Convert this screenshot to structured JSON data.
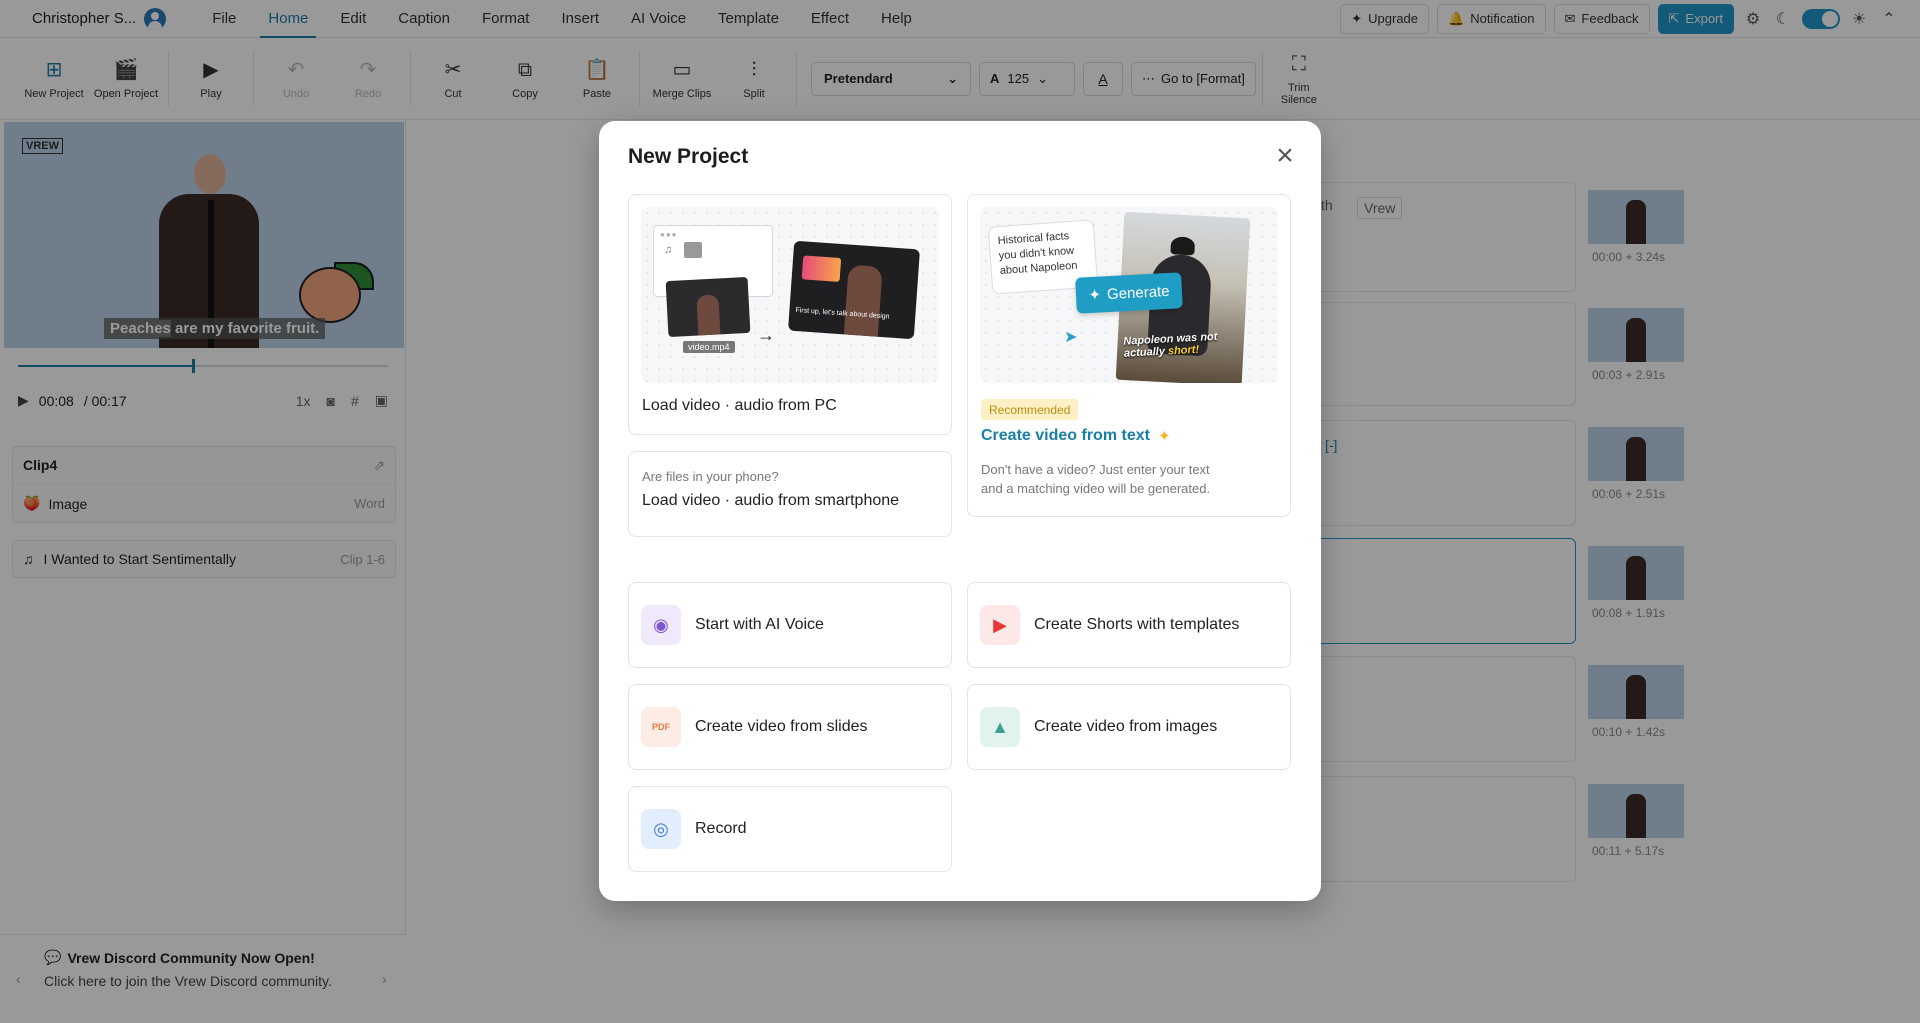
{
  "header": {
    "user_name": "Christopher S...",
    "menus": [
      "File",
      "Home",
      "Edit",
      "Caption",
      "Format",
      "Insert",
      "AI Voice",
      "Template",
      "Effect",
      "Help"
    ],
    "active_menu": "Home",
    "upgrade_label": "Upgrade",
    "notification_label": "Notification",
    "feedback_label": "Feedback",
    "export_label": "Export",
    "accent_color": "#2196c9"
  },
  "toolbar": {
    "new_project": "New Project",
    "open_project": "Open Project",
    "play": "Play",
    "undo": "Undo",
    "redo": "Redo",
    "cut": "Cut",
    "copy": "Copy",
    "paste": "Paste",
    "merge_clips": "Merge Clips",
    "split": "Split",
    "font_name": "Pretendard",
    "font_size": "125",
    "goto_label": "Go to [Format]",
    "trim_silence": "Trim Silence"
  },
  "player": {
    "logo": "VREW",
    "subtitle_highlight": "Peaches",
    "subtitle_rest": " are my favorite fruit.",
    "current_time": "00:08",
    "total_time": "/ 00:17",
    "speed": "1x",
    "progress": 0.47
  },
  "clip_panel": {
    "title": "Clip4",
    "image_label": "Image",
    "image_meta": "Word",
    "music_label": "I Wanted to Start Sentimentally",
    "music_meta": "Clip 1-6"
  },
  "discord": {
    "title": "Vrew Discord Community Now Open!",
    "desc": "Click here to join the Vrew Discord community."
  },
  "background_editor": {
    "tab_frag_1": "th",
    "tab_frag_2": "Vrew",
    "bracket_frag": "[-]",
    "thumb_times": [
      "00:00 + 3.24s",
      "00:03 + 2.91s",
      "00:06 + 2.51s",
      "00:08 + 1.91s",
      "00:10 + 1.42s",
      "00:11 + 5.17s"
    ]
  },
  "modal": {
    "title": "New Project",
    "load_pc": "Load video · audio from PC",
    "file_tag": "video.mp4",
    "video_caption": "First up, let's talk about design",
    "phone_hint": "Are files in your phone?",
    "load_phone": "Load video · audio from smartphone",
    "bubble_text": "Historical facts you didn't know about Napoleon",
    "generate_label": "Generate",
    "napo_caption_1": "Napoleon was",
    "napo_caption_2": "not actually ",
    "napo_caption_accent": "short!",
    "recommended_badge": "Recommended",
    "text_to_video_title": "Create video from text",
    "text_to_video_desc": "Don't have a video? Just enter your text and a matching video will be generated.",
    "ai_voice": "Start with AI Voice",
    "shorts": "Create Shorts with templates",
    "slides": "Create video from slides",
    "images": "Create video from images",
    "record": "Record",
    "pdf_glyph": "PDF"
  }
}
